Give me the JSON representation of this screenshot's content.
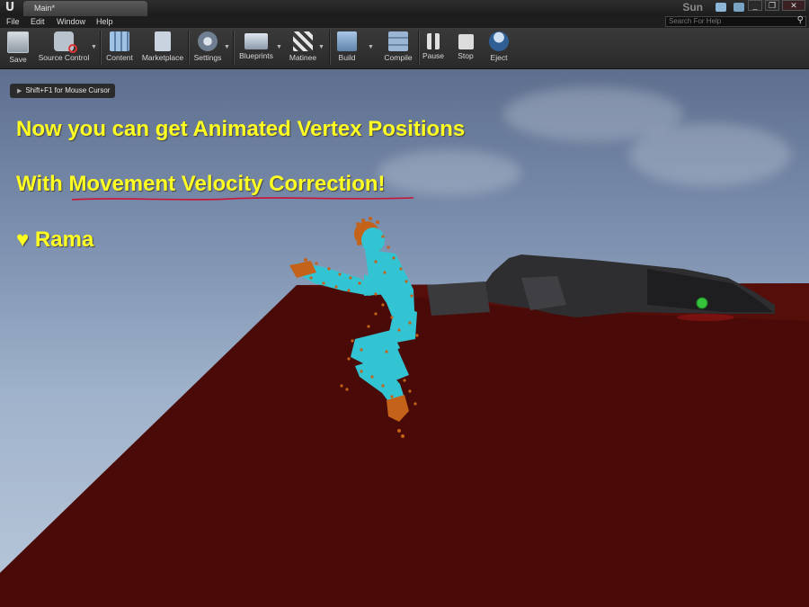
{
  "titlebar": {
    "tab_label": "Main*",
    "project_name": "Sun",
    "minimize": "_",
    "restore": "❐",
    "close": "✕"
  },
  "menu": {
    "items": [
      "File",
      "Edit",
      "Window",
      "Help"
    ]
  },
  "help_search": {
    "placeholder": "Search For Help"
  },
  "toolbar": {
    "save": "Save",
    "source_control": "Source Control",
    "content": "Content",
    "marketplace": "Marketplace",
    "settings": "Settings",
    "blueprints": "Blueprints",
    "matinee": "Matinee",
    "build": "Build",
    "compile": "Compile",
    "pause": "Pause",
    "stop": "Stop",
    "eject": "Eject"
  },
  "viewport": {
    "hint": "Shift+F1 for Mouse Cursor",
    "line1": "Now you can get Animated Vertex Positions",
    "line2_prefix": "With ",
    "line2_highlight": "Movement Velocity Correction!",
    "line3": "♥ Rama"
  },
  "colors": {
    "overlay_text": "#ffff22",
    "underline": "#cc1133",
    "floor": "#4a0b08",
    "character": "#33c4d4",
    "vertex_points": "#c5621a"
  }
}
